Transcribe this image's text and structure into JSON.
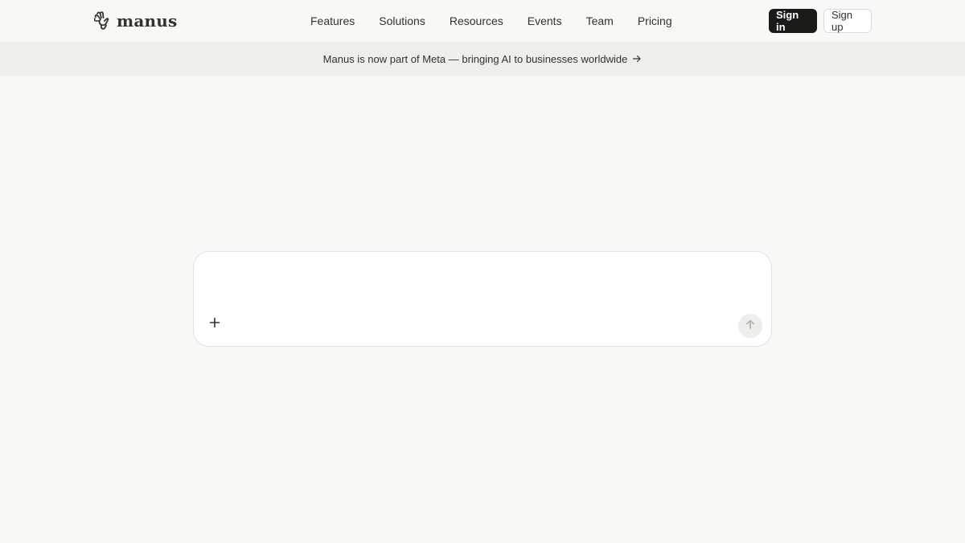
{
  "brand": {
    "name": "manus",
    "logo_icon": "manus-hand-icon"
  },
  "nav": {
    "items": [
      {
        "label": "Features"
      },
      {
        "label": "Solutions"
      },
      {
        "label": "Resources"
      },
      {
        "label": "Events"
      },
      {
        "label": "Team"
      },
      {
        "label": "Pricing"
      }
    ]
  },
  "auth": {
    "sign_in_label": "Sign in",
    "sign_up_label": "Sign up"
  },
  "banner": {
    "text": "Manus is now part of Meta — bringing AI to businesses worldwide",
    "icon": "arrow-right-icon"
  },
  "composer": {
    "value": "",
    "placeholder": "",
    "attach_icon": "plus-icon",
    "send_icon": "arrow-up-icon"
  },
  "colors": {
    "background": "#f8f8f7",
    "banner_background": "#eeeeec",
    "text": "#34322d",
    "sign_in_background": "#1a1a19"
  }
}
